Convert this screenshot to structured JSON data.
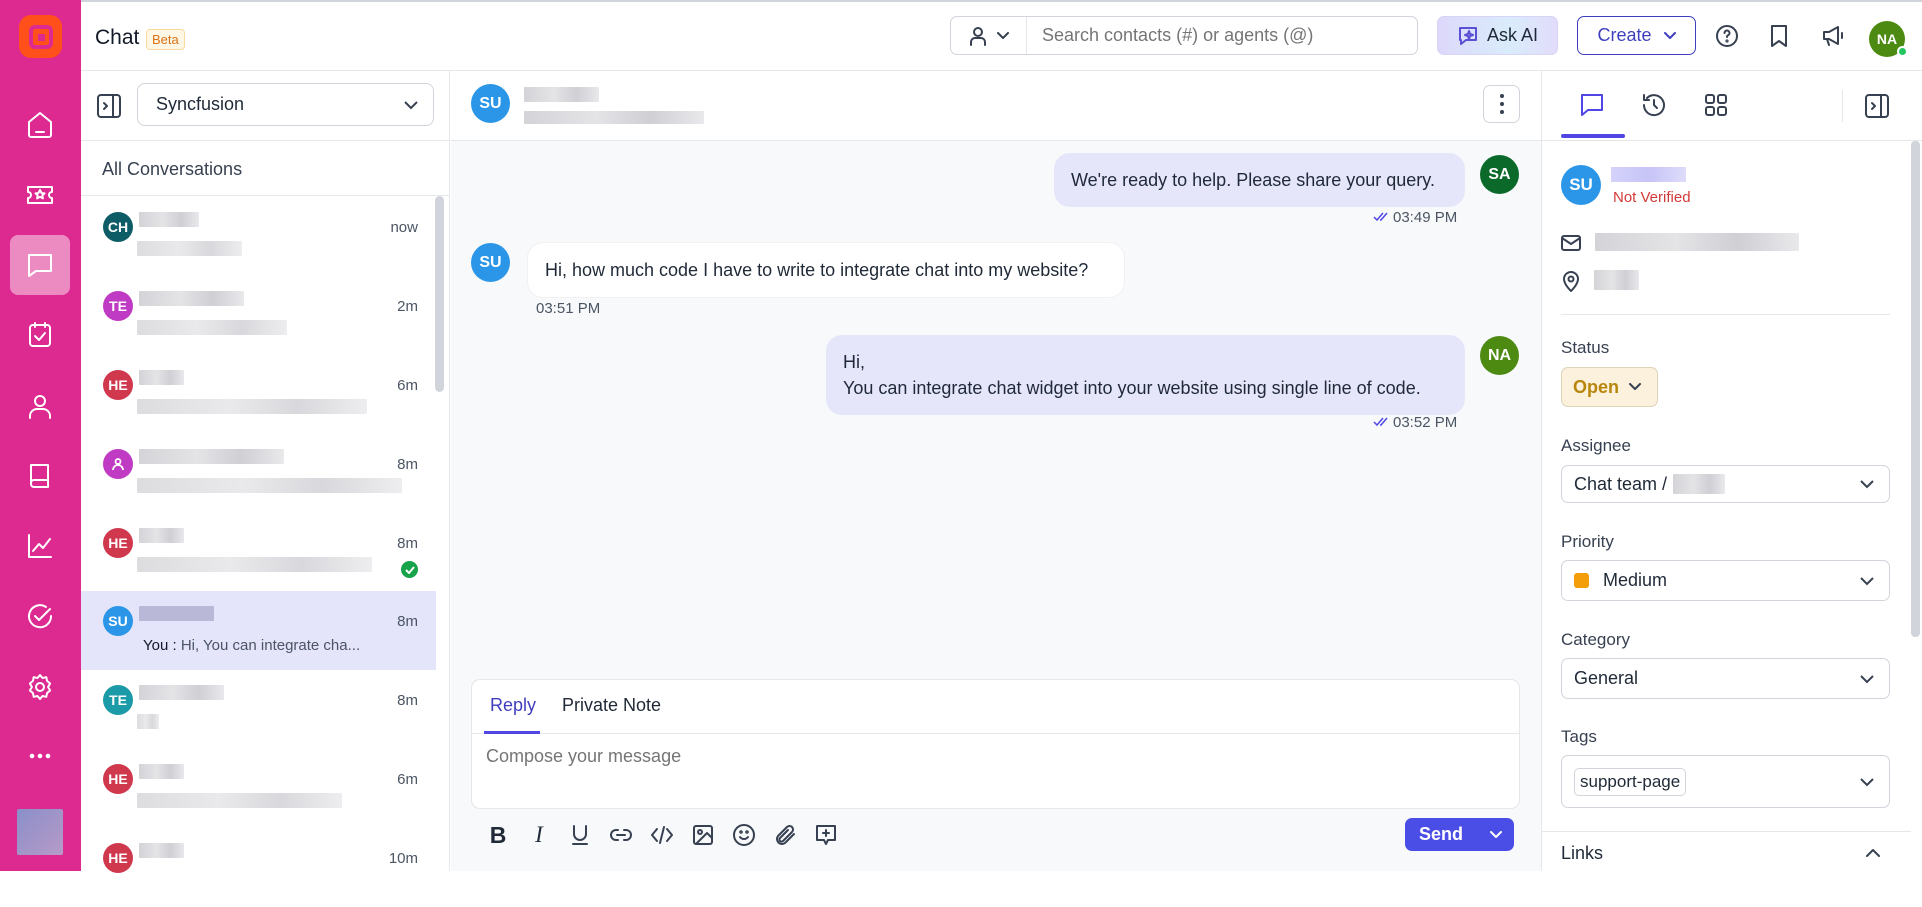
{
  "app": {
    "title": "Chat",
    "badge": "Beta"
  },
  "nav": [
    "home-icon",
    "ticket-icon",
    "chat-icon",
    "task-icon",
    "contacts-icon",
    "knowledge-base-icon",
    "reports-icon",
    "approvals-icon",
    "settings-icon",
    "more-icon"
  ],
  "header": {
    "search_placeholder": "Search contacts (#) or agents (@)",
    "ask_ai": "Ask AI",
    "create": "Create",
    "user_initials": "NA"
  },
  "list": {
    "workspace": "Syncfusion",
    "heading": "All Conversations",
    "conversations": [
      {
        "initials": "CH",
        "color": "#0e5c66",
        "time": "now"
      },
      {
        "initials": "TE",
        "color": "#c03bc4",
        "time": "2m"
      },
      {
        "initials": "HE",
        "color": "#d0384e",
        "time": "6m"
      },
      {
        "initials": "",
        "color": "#c03bc4",
        "time": "8m"
      },
      {
        "initials": "HE",
        "color": "#d0384e",
        "time": "8m",
        "resolved": true
      },
      {
        "initials": "SU",
        "color": "#2b96e8",
        "time": "8m",
        "selected": true,
        "preview_prefix": "You :",
        "preview": "Hi, You can integrate cha..."
      },
      {
        "initials": "TE",
        "color": "#1b9aa8",
        "time": "8m"
      },
      {
        "initials": "HE",
        "color": "#d0384e",
        "time": "6m"
      },
      {
        "initials": "HE",
        "color": "#d0384e",
        "time": "10m"
      }
    ]
  },
  "chat": {
    "contact_initials": "SU",
    "messages": [
      {
        "from": "SA",
        "color": "#0b6a2a",
        "text": "We're ready to help. Please share your query.",
        "time": "03:49 PM",
        "outgoing": true
      },
      {
        "from": "SU",
        "color": "#2b96e8",
        "text": "Hi, how much code I have to write to integrate chat into my website?",
        "time": "03:51 PM",
        "outgoing": false
      },
      {
        "from": "NA",
        "color": "#4d8a12",
        "line1": "Hi,",
        "text": "You can integrate chat widget into your website using single line of code.",
        "time": "03:52 PM",
        "outgoing": true
      }
    ],
    "composer": {
      "tab_reply": "Reply",
      "tab_note": "Private Note",
      "placeholder": "Compose your message",
      "send": "Send"
    }
  },
  "details": {
    "initials": "SU",
    "verification": "Not Verified",
    "status_label": "Status",
    "status": "Open",
    "assignee_label": "Assignee",
    "assignee": "Chat team /",
    "priority_label": "Priority",
    "priority": "Medium",
    "priority_color": "#f59e0b",
    "category_label": "Category",
    "category": "General",
    "tags_label": "Tags",
    "tag": "support-page",
    "links_label": "Links"
  },
  "colors": {
    "sidebar": "#dc2a90",
    "accent": "#4f46e5",
    "send": "#4a4de6"
  }
}
